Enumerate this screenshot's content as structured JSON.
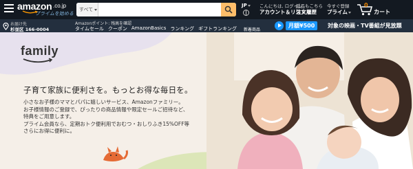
{
  "header": {
    "logo_text": "amazon",
    "logo_tld": ".co.jp",
    "logo_subtext": "プライムを始める",
    "search": {
      "category": "すべて",
      "placeholder": ""
    },
    "language": "JP",
    "account": {
      "line1": "こんにちは, ログイン",
      "line2": "アカウント＆リスト"
    },
    "orders": {
      "line1": "返品もこちら",
      "line2": "注文履歴"
    },
    "prime": {
      "line1": "今すぐ登録",
      "line2": "プライム"
    },
    "cart": {
      "count": "0",
      "label": "カート"
    }
  },
  "subnav": {
    "deliver_line1": "お届け先",
    "deliver_line2": "杉並区 166-0004",
    "points": "Amazonポイント: 残高を確認",
    "links": [
      "タイムセール",
      "クーポン",
      "AmazonBasics",
      "ランキング",
      "ギフトランキング",
      "新着商品"
    ],
    "promo_price": "月額¥500",
    "promo_text": "対象の映画・TV番組が見放題"
  },
  "hero": {
    "logo_text": "family",
    "headline": "子育て家族に便利さを。もっとお得な毎日を。",
    "body": [
      "小さなお子様のママとパパに嬉しいサービス、Amazonファミリー。",
      "お子様情報のご登録で、ぴったりの商品情報や限定セールご招待など、",
      "特典をご用意します。",
      "プライム会員なら、定期おトク便利用でおむつ・おしりふき15%OFF等",
      "さらにお得に便利に。"
    ]
  },
  "colors": {
    "nav_dark": "#131921",
    "nav_secondary": "#232f3e",
    "search_button": "#febd69",
    "promo_blue": "#1a98ff",
    "cart_count": "#f08804",
    "hero_bg": "#f5efe8"
  },
  "icons": [
    "hamburger-icon",
    "search-icon",
    "globe-icon",
    "cart-icon",
    "location-pin-icon",
    "play-icon",
    "dots-decoration",
    "fox-illustration"
  ]
}
